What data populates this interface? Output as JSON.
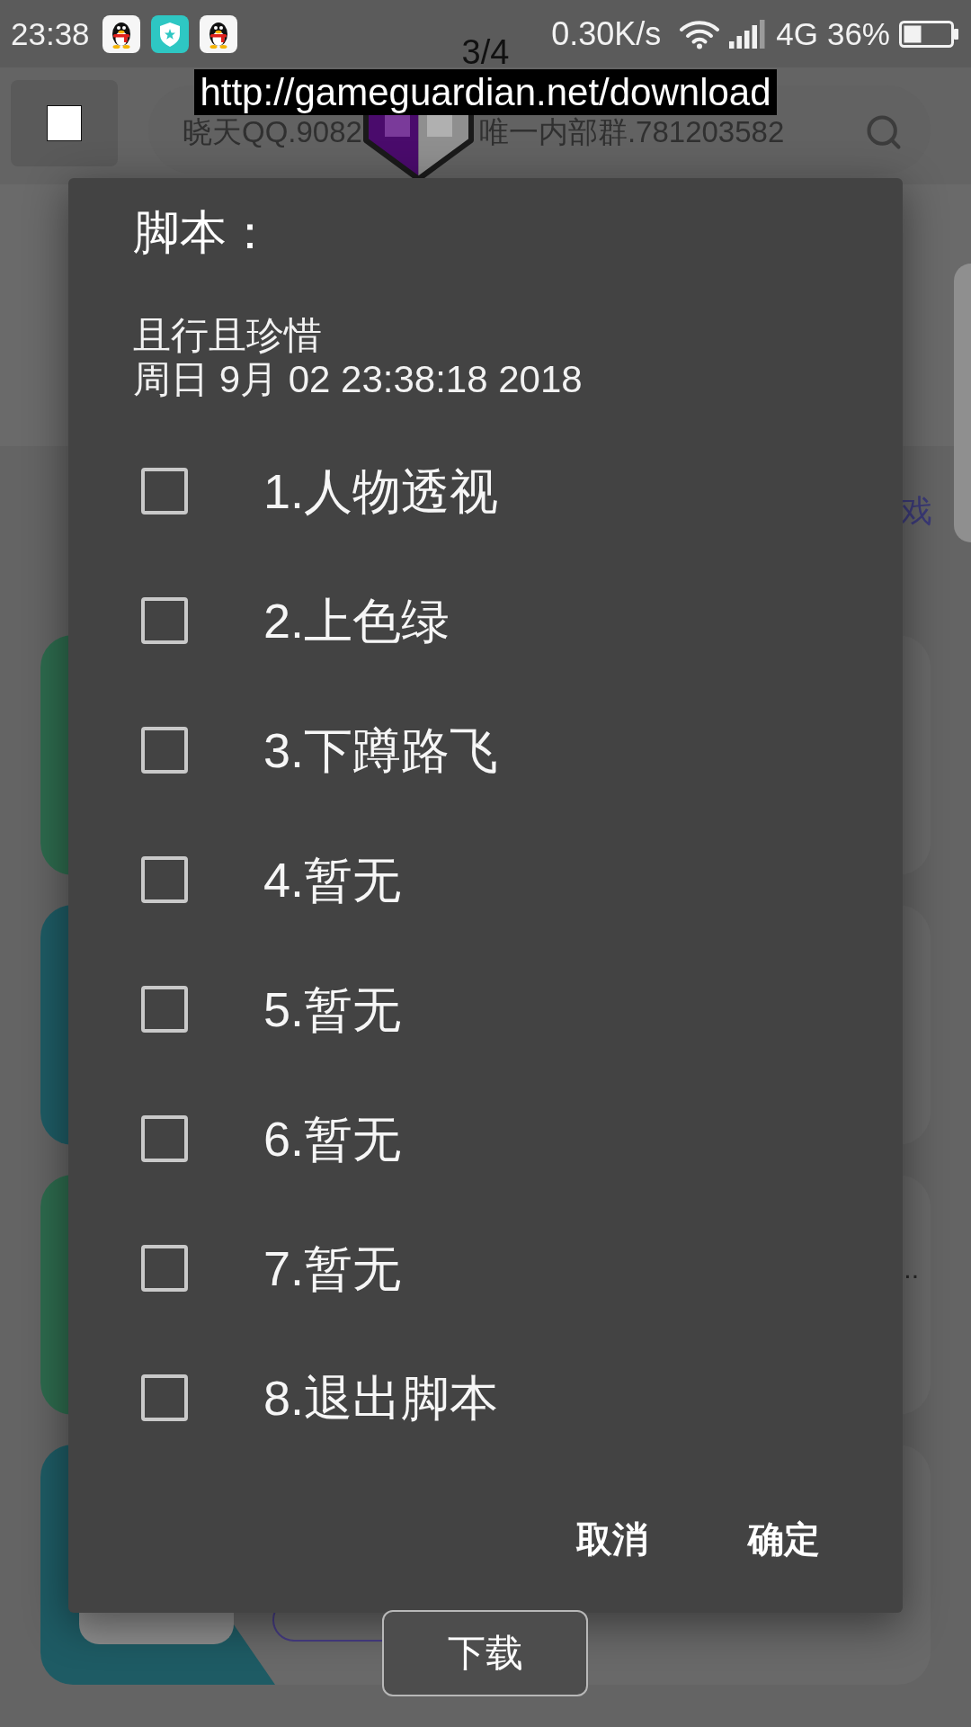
{
  "status_bar": {
    "time": "23:38",
    "speed": "0.30K/s",
    "network": "4G",
    "battery": "36%"
  },
  "overlay": {
    "counter": "3/4",
    "url": "http://gameguardian.net/download"
  },
  "search": {
    "placeholder_parts": [
      "晓天QQ.9082",
      "唯一内部群.781203582"
    ]
  },
  "section": {
    "link": "戏"
  },
  "cards": [
    {
      "color": "#2d6a4d"
    },
    {
      "color": "#1e5b64"
    },
    {
      "color": "#2d6a4d",
      "note": ".."
    },
    {
      "color": "#1e5b64"
    }
  ],
  "dialog": {
    "title": "脚本：",
    "message": [
      "且行且珍惜",
      "周日 9月 02 23:38:18 2018"
    ],
    "options": [
      {
        "label": "1.人物透视",
        "checked": false
      },
      {
        "label": "2.上色绿",
        "checked": false
      },
      {
        "label": "3.下蹲路飞",
        "checked": false
      },
      {
        "label": "4.暂无",
        "checked": false
      },
      {
        "label": "5.暂无",
        "checked": false
      },
      {
        "label": "6.暂无",
        "checked": false
      },
      {
        "label": "7.暂无",
        "checked": false
      },
      {
        "label": "8.退出脚本",
        "checked": false
      }
    ],
    "buttons": [
      "取消",
      "确定"
    ]
  },
  "download_button": "下载"
}
